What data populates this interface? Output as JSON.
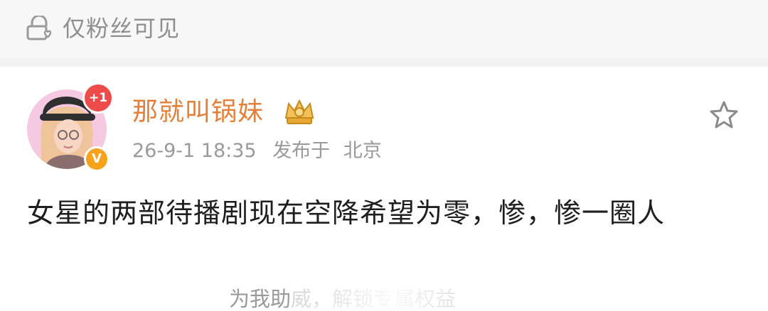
{
  "topbar": {
    "visibility_label": "仅粉丝可见",
    "icon": "lock-heart-icon"
  },
  "post": {
    "avatar": {
      "badge_text": "+1",
      "verified_text": "V"
    },
    "username": "那就叫锅妹",
    "rank_icon": "crown-badge-icon",
    "timestamp": "26-9-1 18:35",
    "published_at": "发布于",
    "location": "北京",
    "favorite_icon": "star-icon",
    "content": "女星的两部待播剧现在空降希望为零，惨，惨一圈人"
  },
  "footer": {
    "partial_text": "为我助威，解锁专属权益"
  },
  "colors": {
    "username": "#e5803b",
    "muted": "#9a9a9a",
    "badge_red": "#f04b4b",
    "verified_orange": "#f7a21b"
  }
}
